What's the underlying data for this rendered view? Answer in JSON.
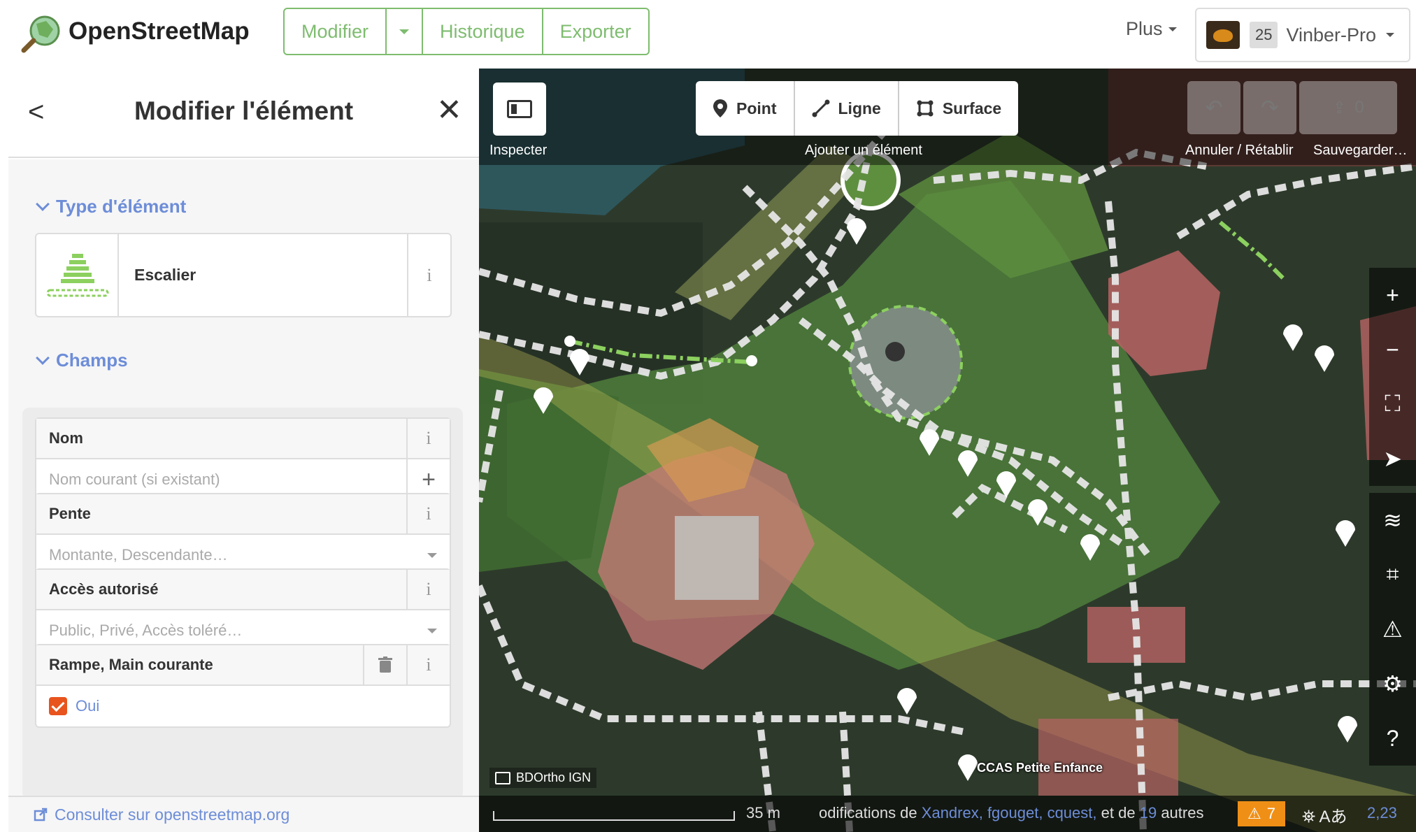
{
  "header": {
    "logo_text": "OpenStreetMap",
    "edit_label": "Modifier",
    "history_label": "Historique",
    "export_label": "Exporter",
    "more_label": "Plus",
    "user_count": "25",
    "user_name": "Vinber-Pro"
  },
  "sidebar": {
    "title": "Modifier l'élément",
    "back": "<",
    "close": "✕",
    "type_section": "Type d'élément",
    "preset_name": "Escalier",
    "fields_section": "Champs",
    "info_glyph": "i",
    "fields": {
      "name": {
        "label": "Nom",
        "placeholder": "Nom courant (si existant)"
      },
      "incline": {
        "label": "Pente",
        "placeholder": "Montante, Descendante…"
      },
      "access": {
        "label": "Accès autorisé",
        "placeholder": "Public, Privé, Accès toléré…"
      },
      "ramp": {
        "label": "Rampe, Main courante",
        "checkbox_label": "Oui",
        "checked": true
      }
    },
    "footer_link": "Consulter sur openstreetmap.org"
  },
  "map": {
    "inspect_label": "Inspecter",
    "add_point": "Point",
    "add_line": "Ligne",
    "add_area": "Surface",
    "add_label": "Ajouter un élément",
    "undo_label": "Annuler / Rétablir",
    "save_label": "Sauvegarder…",
    "save_count": "0",
    "background_label": "BDOrtho IGN",
    "poi_label": "CCAS Petite Enfance",
    "scale_label": "35 m",
    "attribution_prefix": "odifications de",
    "attribution_users": "Xandrex, fgouget, cquest,",
    "attribution_mid": "et de",
    "attribution_count": "19",
    "attribution_suffix": "autres",
    "issues_count": "7",
    "coordinates": "2,23",
    "icons": [
      "sidebar-toggle-icon",
      "map-pin-icon",
      "line-icon",
      "area-icon",
      "undo-icon",
      "redo-icon",
      "upload-icon",
      "zoom-in-icon",
      "zoom-out-icon",
      "zoom-to-selection-icon",
      "geolocate-icon",
      "layers-icon",
      "map-data-icon",
      "issues-icon",
      "preferences-icon",
      "help-icon"
    ]
  },
  "colors": {
    "osm_green": "#7ebc6f",
    "link_blue": "#6d8dd8",
    "checkbox_orange": "#e8541d",
    "issues_orange": "#f08f16"
  }
}
